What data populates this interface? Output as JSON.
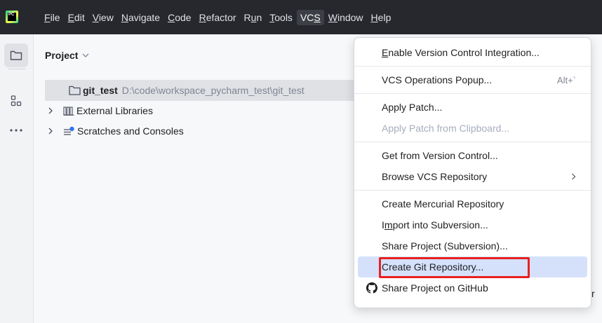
{
  "menubar": {
    "items": [
      {
        "mn": "F",
        "rest": "ile"
      },
      {
        "mn": "E",
        "rest": "dit"
      },
      {
        "mn": "V",
        "rest": "iew"
      },
      {
        "mn": "N",
        "rest": "avigate"
      },
      {
        "mn": "C",
        "rest": "ode"
      },
      {
        "mn": "R",
        "rest": "efactor"
      },
      {
        "pre": "R",
        "mn": "u",
        "rest": "n"
      },
      {
        "mn": "T",
        "rest": "ools"
      },
      {
        "pre": "VC",
        "mn": "S",
        "rest": ""
      },
      {
        "mn": "W",
        "rest": "indow"
      },
      {
        "mn": "H",
        "rest": "elp"
      }
    ]
  },
  "logo": {
    "text": "PC"
  },
  "project": {
    "header": "Project",
    "tree": [
      {
        "name": "git_test",
        "path": "D:\\code\\workspace_pycharm_test\\git_test"
      },
      {
        "name": "External Libraries"
      },
      {
        "name": "Scratches and Consoles"
      }
    ]
  },
  "vcs_menu": {
    "enable_vci": {
      "mn": "E",
      "rest": "nable Version Control Integration..."
    },
    "ops_popup": {
      "label": "VCS Operations Popup...",
      "shortcut": "Alt+`"
    },
    "apply_patch": "Apply Patch...",
    "apply_clipboard": "Apply Patch from Clipboard...",
    "get_from_vc": "Get from Version Control...",
    "browse_repo": "Browse VCS Repository",
    "create_hg": "Create Mercurial Repository",
    "import_svn": {
      "pre": "I",
      "mn": "m",
      "rest": "port into Subversion..."
    },
    "share_svn": "Share Project (Subversion)...",
    "create_git": "Create Git Repository...",
    "share_github": "Share Project on GitHub"
  },
  "edge_letter": "r",
  "colors": {
    "highlight": "#d5e1fb",
    "callout": "#e8201f",
    "menubar": "#27282e"
  }
}
